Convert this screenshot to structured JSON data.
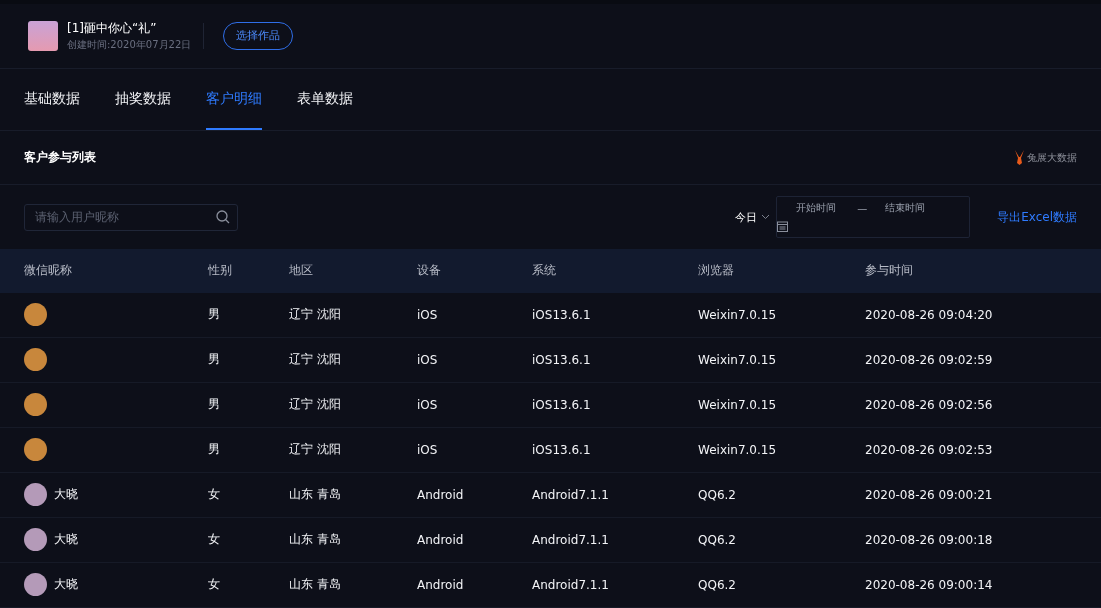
{
  "work": {
    "title": "[1]砸中你心“礼”",
    "created": "创建时间:2020年07月22日",
    "select_button": "选择作品"
  },
  "tabs": [
    {
      "label": "基础数据",
      "selected": false
    },
    {
      "label": "抽奖数据",
      "selected": false
    },
    {
      "label": "客户明细",
      "selected": true
    },
    {
      "label": "表单数据",
      "selected": false
    }
  ],
  "section": {
    "title": "客户参与列表",
    "brand": "兔展大数据"
  },
  "filters": {
    "search_placeholder": "请输入用户昵称",
    "period": "今日",
    "start_placeholder": "开始时间",
    "separator": "—",
    "end_placeholder": "结束时间",
    "export": "导出Excel数据"
  },
  "table": {
    "columns": [
      "微信昵称",
      "性别",
      "地区",
      "设备",
      "系统",
      "浏览器",
      "参与时间"
    ],
    "rows": [
      {
        "color": "#c8873c",
        "cells": [
          "",
          "男",
          "辽宁 沈阳",
          "iOS",
          "iOS13.6.1",
          "Weixin7.0.15",
          "2020-08-26 09:04:20"
        ]
      },
      {
        "color": "#c8873c",
        "cells": [
          "",
          "男",
          "辽宁 沈阳",
          "iOS",
          "iOS13.6.1",
          "Weixin7.0.15",
          "2020-08-26 09:02:59"
        ]
      },
      {
        "color": "#c8873c",
        "cells": [
          "",
          "男",
          "辽宁 沈阳",
          "iOS",
          "iOS13.6.1",
          "Weixin7.0.15",
          "2020-08-26 09:02:56"
        ]
      },
      {
        "color": "#c8873c",
        "cells": [
          "",
          "男",
          "辽宁 沈阳",
          "iOS",
          "iOS13.6.1",
          "Weixin7.0.15",
          "2020-08-26 09:02:53"
        ]
      },
      {
        "color": "#b49ab8",
        "cells": [
          "大晓",
          "女",
          "山东 青岛",
          "Android",
          "Android7.1.1",
          "QQ6.2",
          "2020-08-26 09:00:21"
        ]
      },
      {
        "color": "#b49ab8",
        "cells": [
          "大晓",
          "女",
          "山东 青岛",
          "Android",
          "Android7.1.1",
          "QQ6.2",
          "2020-08-26 09:00:18"
        ]
      },
      {
        "color": "#b49ab8",
        "cells": [
          "大晓",
          "女",
          "山东 青岛",
          "Android",
          "Android7.1.1",
          "QQ6.2",
          "2020-08-26 09:00:14"
        ]
      }
    ]
  }
}
